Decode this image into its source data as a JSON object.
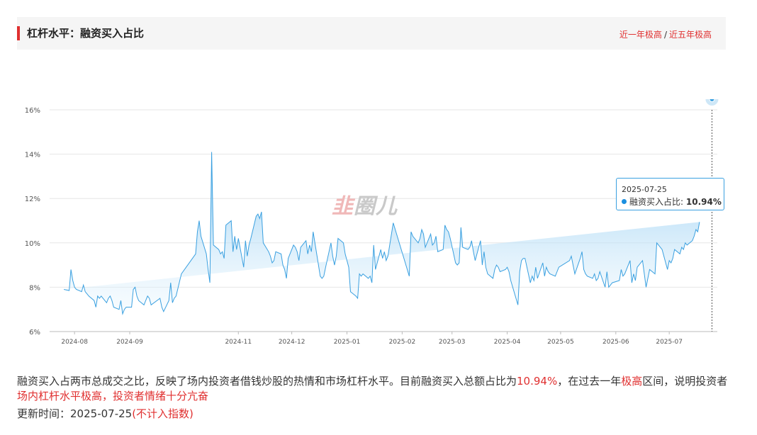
{
  "header": {
    "title": "杠杆水平：融资买入占比",
    "link_year": "近一年极高",
    "link_sep": "/",
    "link_five_year": "近五年极高"
  },
  "watermark": {
    "part1": "韭",
    "part2": "圈儿"
  },
  "tooltip": {
    "date": "2025-07-25",
    "series_label": "融资买入占比:",
    "value": "10.94%"
  },
  "description": {
    "part1": "融资买入占两市总成交之比，反映了场内投资者借钱炒股的热情和市场杠杆水平。目前融资买入总额占比为",
    "value": "10.94%",
    "part2": "，在过去一年",
    "level": "极高",
    "part3": "区间，说明投资者",
    "conclusion": "场内杠杆水平极高，投资者情绪十分亢奋"
  },
  "update": {
    "label": "更新时间：",
    "date": "2025-07-25",
    "note": "(不计入指数)"
  },
  "colors": {
    "accent": "#e03030",
    "line": "#3aa0e0",
    "area_top": "#a9d7f5"
  },
  "chart_data": {
    "type": "area",
    "title": "",
    "xlabel": "",
    "ylabel": "",
    "ylim": [
      6,
      16
    ],
    "yticks": [
      "6%",
      "8%",
      "10%",
      "12%",
      "14%",
      "16%"
    ],
    "xticks": [
      "2024-08",
      "2024-09",
      "2024-11",
      "2024-12",
      "2025-01",
      "2025-02",
      "2025-03",
      "2025-04",
      "2025-05",
      "2025-06",
      "2025-07"
    ],
    "grid": true,
    "x": [
      "2024-07-26",
      "2024-07-29",
      "2024-07-30",
      "2024-07-31",
      "2024-08-01",
      "2024-08-02",
      "2024-08-05",
      "2024-08-06",
      "2024-08-07",
      "2024-08-08",
      "2024-08-09",
      "2024-08-12",
      "2024-08-13",
      "2024-08-14",
      "2024-08-15",
      "2024-08-16",
      "2024-08-19",
      "2024-08-20",
      "2024-08-21",
      "2024-08-22",
      "2024-08-23",
      "2024-08-26",
      "2024-08-27",
      "2024-08-28",
      "2024-08-29",
      "2024-08-30",
      "2024-09-02",
      "2024-09-03",
      "2024-09-04",
      "2024-09-05",
      "2024-09-06",
      "2024-09-09",
      "2024-09-10",
      "2024-09-11",
      "2024-09-12",
      "2024-09-13",
      "2024-09-18",
      "2024-09-19",
      "2024-09-20",
      "2024-09-23",
      "2024-09-24",
      "2024-09-25",
      "2024-09-26",
      "2024-09-27",
      "2024-09-30",
      "2024-10-08",
      "2024-10-09",
      "2024-10-10",
      "2024-10-11",
      "2024-10-14",
      "2024-10-15",
      "2024-10-16",
      "2024-10-17",
      "2024-10-18",
      "2024-10-21",
      "2024-10-22",
      "2024-10-23",
      "2024-10-24",
      "2024-10-25",
      "2024-10-28",
      "2024-10-29",
      "2024-10-30",
      "2024-10-31",
      "2024-11-01",
      "2024-11-04",
      "2024-11-05",
      "2024-11-06",
      "2024-11-07",
      "2024-11-08",
      "2024-11-11",
      "2024-11-12",
      "2024-11-13",
      "2024-11-14",
      "2024-11-15",
      "2024-11-18",
      "2024-11-19",
      "2024-11-20",
      "2024-11-21",
      "2024-11-22",
      "2024-11-25",
      "2024-11-26",
      "2024-11-27",
      "2024-11-28",
      "2024-11-29",
      "2024-12-02",
      "2024-12-03",
      "2024-12-04",
      "2024-12-05",
      "2024-12-06",
      "2024-12-09",
      "2024-12-10",
      "2024-12-11",
      "2024-12-12",
      "2024-12-13",
      "2024-12-16",
      "2024-12-17",
      "2024-12-18",
      "2024-12-19",
      "2024-12-20",
      "2024-12-23",
      "2024-12-24",
      "2024-12-25",
      "2024-12-26",
      "2024-12-27",
      "2024-12-30",
      "2024-12-31",
      "2025-01-02",
      "2025-01-03",
      "2025-01-06",
      "2025-01-07",
      "2025-01-08",
      "2025-01-09",
      "2025-01-10",
      "2025-01-13",
      "2025-01-14",
      "2025-01-15",
      "2025-01-16",
      "2025-01-17",
      "2025-01-20",
      "2025-01-21",
      "2025-01-22",
      "2025-01-23",
      "2025-01-24",
      "2025-01-27",
      "2025-02-05",
      "2025-02-06",
      "2025-02-07",
      "2025-02-10",
      "2025-02-11",
      "2025-02-12",
      "2025-02-13",
      "2025-02-14",
      "2025-02-17",
      "2025-02-18",
      "2025-02-19",
      "2025-02-20",
      "2025-02-21",
      "2025-02-24",
      "2025-02-25",
      "2025-02-26",
      "2025-02-27",
      "2025-02-28",
      "2025-03-03",
      "2025-03-04",
      "2025-03-05",
      "2025-03-06",
      "2025-03-07",
      "2025-03-10",
      "2025-03-11",
      "2025-03-12",
      "2025-03-13",
      "2025-03-14",
      "2025-03-17",
      "2025-03-18",
      "2025-03-19",
      "2025-03-20",
      "2025-03-21",
      "2025-03-24",
      "2025-03-25",
      "2025-03-26",
      "2025-03-27",
      "2025-03-28",
      "2025-03-31",
      "2025-04-01",
      "2025-04-02",
      "2025-04-03",
      "2025-04-07",
      "2025-04-08",
      "2025-04-09",
      "2025-04-10",
      "2025-04-11",
      "2025-04-14",
      "2025-04-15",
      "2025-04-16",
      "2025-04-17",
      "2025-04-18",
      "2025-04-21",
      "2025-04-22",
      "2025-04-23",
      "2025-04-24",
      "2025-04-25",
      "2025-04-28",
      "2025-04-29",
      "2025-04-30",
      "2025-05-06",
      "2025-05-07",
      "2025-05-08",
      "2025-05-09",
      "2025-05-12",
      "2025-05-13",
      "2025-05-14",
      "2025-05-15",
      "2025-05-16",
      "2025-05-19",
      "2025-05-20",
      "2025-05-21",
      "2025-05-22",
      "2025-05-23",
      "2025-05-26",
      "2025-05-27",
      "2025-05-28",
      "2025-05-29",
      "2025-05-30",
      "2025-06-03",
      "2025-06-04",
      "2025-06-05",
      "2025-06-06",
      "2025-06-09",
      "2025-06-10",
      "2025-06-11",
      "2025-06-12",
      "2025-06-13",
      "2025-06-16",
      "2025-06-17",
      "2025-06-18",
      "2025-06-19",
      "2025-06-20",
      "2025-06-23",
      "2025-06-24",
      "2025-06-25",
      "2025-06-26",
      "2025-06-27",
      "2025-06-30",
      "2025-07-01",
      "2025-07-02",
      "2025-07-03",
      "2025-07-04",
      "2025-07-07",
      "2025-07-08",
      "2025-07-09",
      "2025-07-10",
      "2025-07-11",
      "2025-07-14",
      "2025-07-15",
      "2025-07-16",
      "2025-07-17",
      "2025-07-18",
      "2025-07-21",
      "2025-07-22",
      "2025-07-23",
      "2025-07-24",
      "2025-07-25"
    ],
    "series": [
      {
        "values": [
          7.9,
          7.85,
          8.8,
          8.3,
          8.0,
          7.9,
          7.8,
          8.1,
          7.8,
          7.7,
          7.6,
          7.4,
          7.1,
          7.6,
          7.5,
          7.6,
          7.3,
          7.5,
          7.6,
          7.4,
          7.1,
          7.0,
          7.4,
          6.8,
          7.0,
          7.1,
          7.1,
          7.9,
          8.0,
          7.6,
          7.4,
          7.2,
          7.4,
          7.6,
          7.5,
          7.2,
          7.5,
          7.1,
          6.9,
          7.4,
          8.2,
          7.3,
          7.5,
          7.6,
          8.6,
          9.5,
          10.5,
          11.0,
          10.3,
          9.5,
          8.8,
          8.2,
          14.1,
          9.9,
          9.7,
          9.5,
          9.6,
          9.3,
          10.8,
          11.0,
          9.6,
          10.3,
          9.7,
          10.2,
          8.9,
          10.1,
          9.4,
          9.9,
          10.2,
          11.2,
          11.3,
          11.1,
          11.4,
          10.0,
          9.6,
          9.4,
          9.1,
          9.2,
          9.6,
          9.5,
          9.0,
          8.8,
          8.4,
          9.3,
          9.9,
          9.8,
          9.6,
          9.2,
          9.8,
          10.1,
          9.5,
          9.9,
          9.6,
          10.5,
          9.0,
          8.5,
          8.4,
          8.5,
          8.9,
          10.0,
          9.4,
          9.0,
          9.4,
          10.2,
          10.0,
          9.5,
          8.9,
          7.8,
          7.6,
          7.5,
          8.6,
          8.5,
          8.6,
          8.4,
          8.5,
          8.2,
          9.9,
          8.8,
          9.7,
          9.3,
          9.6,
          9.2,
          9.4,
          10.9,
          8.5,
          10.5,
          10.3,
          10.0,
          10.2,
          10.6,
          10.4,
          9.8,
          10.4,
          9.9,
          10.0,
          10.3,
          9.6,
          9.7,
          10.8,
          10.6,
          10.5,
          10.2,
          9.1,
          9.0,
          9.1,
          10.7,
          9.8,
          9.7,
          9.8,
          10.1,
          9.6,
          9.2,
          10.1,
          9.0,
          9.6,
          8.9,
          8.6,
          8.4,
          8.8,
          9.0,
          8.9,
          8.7,
          8.8,
          8.9,
          8.7,
          8.3,
          7.2,
          8.7,
          9.2,
          9.3,
          9.3,
          8.2,
          8.5,
          8.3,
          8.9,
          8.4,
          9.1,
          8.5,
          8.9,
          8.7,
          8.6,
          8.5,
          8.7,
          8.9,
          9.2,
          9.4,
          9.0,
          8.6,
          9.3,
          9.6,
          8.8,
          8.6,
          8.5,
          8.4,
          8.6,
          8.3,
          8.4,
          8.7,
          8.0,
          8.7,
          8.0,
          8.1,
          8.2,
          8.3,
          8.8,
          8.5,
          8.6,
          9.2,
          8.2,
          8.6,
          8.3,
          8.9,
          9.2,
          8.6,
          8.0,
          8.4,
          8.8,
          8.6,
          10.0,
          9.9,
          9.8,
          9.7,
          8.8,
          9.2,
          9.1,
          9.3,
          9.7,
          9.5,
          9.8,
          9.7,
          10.0,
          9.9,
          10.1,
          10.3,
          10.6,
          10.5,
          10.94
        ]
      }
    ]
  }
}
